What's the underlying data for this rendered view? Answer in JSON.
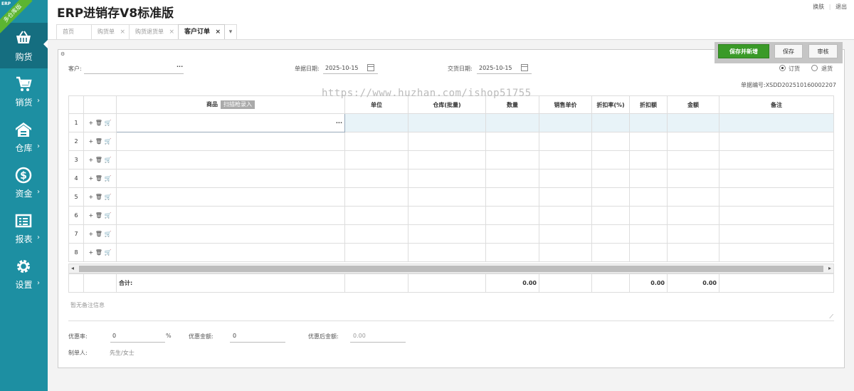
{
  "app": {
    "title": "ERP进销存V8标准版",
    "badge": "多仓库版",
    "badge_tag": "ERP",
    "links": [
      "换肤",
      "|",
      "退出"
    ]
  },
  "sidebar": {
    "items": [
      {
        "label": "购货",
        "icon": "basket-icon",
        "active": true
      },
      {
        "label": "销货",
        "icon": "cart-icon"
      },
      {
        "label": "仓库",
        "icon": "warehouse-icon"
      },
      {
        "label": "资金",
        "icon": "dollar-icon"
      },
      {
        "label": "报表",
        "icon": "report-icon"
      },
      {
        "label": "设置",
        "icon": "gear-icon"
      }
    ]
  },
  "tabs": [
    {
      "label": "首页",
      "closable": false
    },
    {
      "label": "购货单",
      "closable": true
    },
    {
      "label": "购货退货单",
      "closable": true
    },
    {
      "label": "客户订单",
      "closable": true,
      "active": true
    }
  ],
  "toolbar": {
    "save_new": "保存并新增",
    "save": "保存",
    "audit": "审核"
  },
  "form": {
    "customer_label": "客户:",
    "customer_value": "",
    "customer_more": "···",
    "doc_date_label": "单据日期:",
    "doc_date": "2025-10-15",
    "delivery_date_label": "交货日期:",
    "delivery_date": "2025-10-15",
    "order_type": {
      "options": [
        "订货",
        "退货"
      ],
      "selected": "订货"
    },
    "doc_no": "单据编号:XSDD202510160002207"
  },
  "watermark": "https://www.huzhan.com/ishop51755",
  "grid": {
    "columns": [
      "商品",
      "单位",
      "仓库(批量)",
      "数量",
      "销售单价",
      "折扣率(%)",
      "折扣额",
      "金额",
      "备注"
    ],
    "scan_button": "扫描枪录入",
    "row_numbers": [
      "1",
      "2",
      "3",
      "4",
      "5",
      "6",
      "7",
      "8"
    ],
    "product_more": "···",
    "row_ops": "+ 🗑 🛒"
  },
  "totals": {
    "label": "合计:",
    "qty": "0.00",
    "discount_amt": "0.00",
    "amount": "0.00"
  },
  "remark_placeholder": "暂无备注信息",
  "footer": {
    "discount_rate_label": "优惠率:",
    "discount_rate": "0",
    "percent": "%",
    "discount_amount_label": "优惠金额:",
    "discount_amount": "0",
    "after_discount_label": "优惠后金额:",
    "after_discount": "0.00",
    "maker_label": "制单人:",
    "maker": "先生/女士"
  }
}
